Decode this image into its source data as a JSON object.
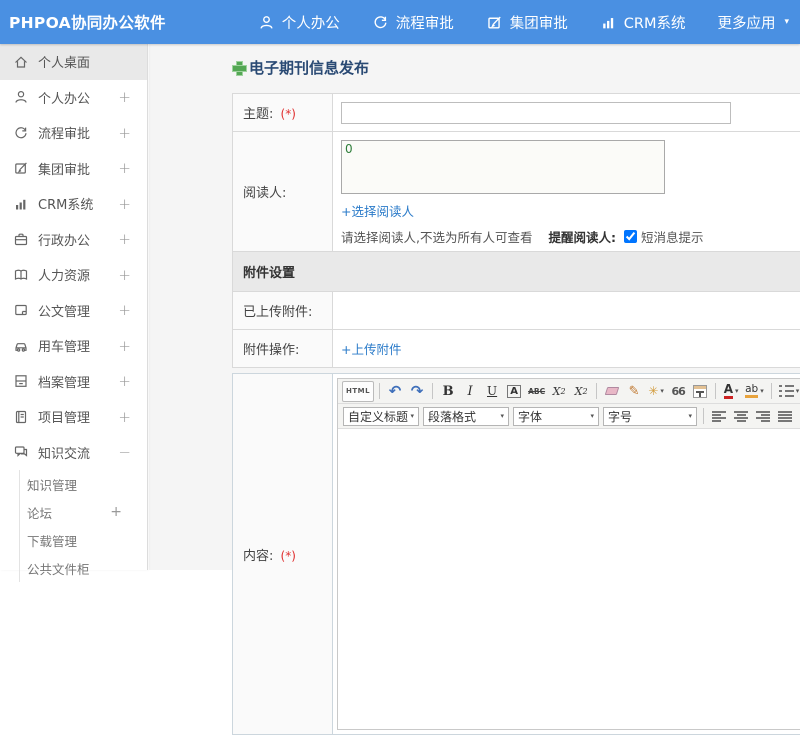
{
  "colors": {
    "topbar": "#4a90e2",
    "link": "#2b7bc9",
    "required": "#e03131",
    "title": "#2a4a74",
    "plus_green": "#54a754",
    "active_item_bg": "#e9e9e9"
  },
  "header": {
    "logo": "PHPOA协同办公软件",
    "nav": [
      {
        "label": "个人办公",
        "icon": "person-icon"
      },
      {
        "label": "流程审批",
        "icon": "refresh-icon"
      },
      {
        "label": "集团审批",
        "icon": "edit-icon"
      },
      {
        "label": "CRM系统",
        "icon": "chart-icon"
      },
      {
        "label": "更多应用",
        "icon": "caret-down-icon"
      }
    ]
  },
  "sidebar": {
    "items": [
      {
        "label": "个人桌面",
        "icon": "home-icon",
        "active": true,
        "expand": ""
      },
      {
        "label": "个人办公",
        "icon": "person-icon",
        "expand": "+"
      },
      {
        "label": "流程审批",
        "icon": "refresh-icon",
        "expand": "+"
      },
      {
        "label": "集团审批",
        "icon": "edit-icon",
        "expand": "+"
      },
      {
        "label": "CRM系统",
        "icon": "chart-icon",
        "expand": "+"
      },
      {
        "label": "行政办公",
        "icon": "briefcase-icon",
        "expand": "+"
      },
      {
        "label": "人力资源",
        "icon": "book-icon",
        "expand": "+"
      },
      {
        "label": "公文管理",
        "icon": "document-icon",
        "expand": "+"
      },
      {
        "label": "用车管理",
        "icon": "car-icon",
        "expand": "+"
      },
      {
        "label": "档案管理",
        "icon": "archive-icon",
        "expand": "+"
      },
      {
        "label": "项目管理",
        "icon": "notebook-icon",
        "expand": "+"
      },
      {
        "label": "知识交流",
        "icon": "chat-icon",
        "expand": "−",
        "expanded": true
      }
    ],
    "sub_items": [
      {
        "label": "知识管理",
        "expand": ""
      },
      {
        "label": "论坛",
        "expand": "+"
      },
      {
        "label": "下载管理",
        "expand": ""
      },
      {
        "label": "公共文件柜",
        "expand": ""
      }
    ]
  },
  "main": {
    "page_title": "电子期刊信息发布",
    "form": {
      "subject_label": "主题:",
      "required_mark": "(*)",
      "readers_label": "阅读人:",
      "readers_value": "0",
      "select_readers_link": "+选择阅读人",
      "readers_note": "请选择阅读人,不选为所有人可查看",
      "remind_label": "提醒阅读人:",
      "sms_label": "短消息提示",
      "attachments_header": "附件设置",
      "uploaded_label": "已上传附件:",
      "ops_label": "附件操作:",
      "upload_link": "+上传附件",
      "content_label": "内容:"
    },
    "editor": {
      "html_label": "HTML",
      "undo_glyph": "↶",
      "redo_glyph": "↷",
      "bold": "B",
      "italic": "I",
      "underline": "U",
      "boxed_a": "A",
      "strike_abc": "ABC",
      "sup_base": "X",
      "sup_exp": "2",
      "sub_base": "X",
      "sub_exp": "2",
      "brush_glyph": "✎",
      "wand_glyph": "✳",
      "quote": "66",
      "font_a": "A",
      "highlight_ab": "ab",
      "link_glyph": "∞",
      "unlink_glyph": "⊘",
      "dropdowns": [
        "自定义标题",
        "段落格式",
        "字体",
        "字号"
      ]
    }
  },
  "glyphs": {
    "caret_down": "▾"
  }
}
